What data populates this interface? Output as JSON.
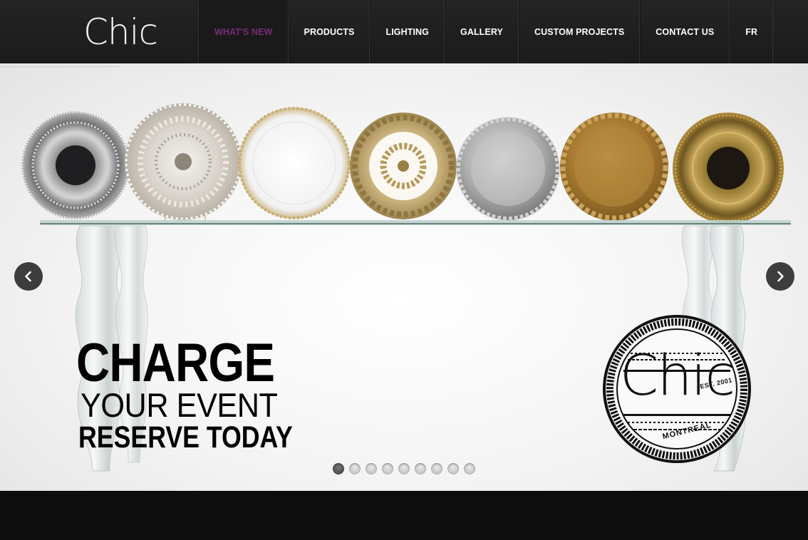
{
  "brand": {
    "logo_text": "Chic"
  },
  "nav": {
    "items": [
      {
        "label": "WHAT'S NEW",
        "active": true
      },
      {
        "label": "PRODUCTS",
        "active": false
      },
      {
        "label": "LIGHTING",
        "active": false
      },
      {
        "label": "GALLERY",
        "active": false
      },
      {
        "label": "CUSTOM PROJECTS",
        "active": false
      },
      {
        "label": "CONTACT US",
        "active": false
      },
      {
        "label": "FR",
        "active": false
      }
    ]
  },
  "slider": {
    "headline_line1": "CHARGE",
    "headline_line2": "YOUR EVENT",
    "headline_line3": "RESERVE TODAY",
    "stamp": {
      "brand": "Chic",
      "est": "EST. 2001",
      "city": "MONTREAL"
    },
    "slide_count": 9,
    "active_slide": 1,
    "prev_icon": "chevron-left-icon",
    "next_icon": "chevron-right-icon"
  },
  "colors": {
    "header_bg": "#1f1f1f",
    "active_nav": "#7a2a78",
    "footer_bg": "#0d0d0e"
  }
}
